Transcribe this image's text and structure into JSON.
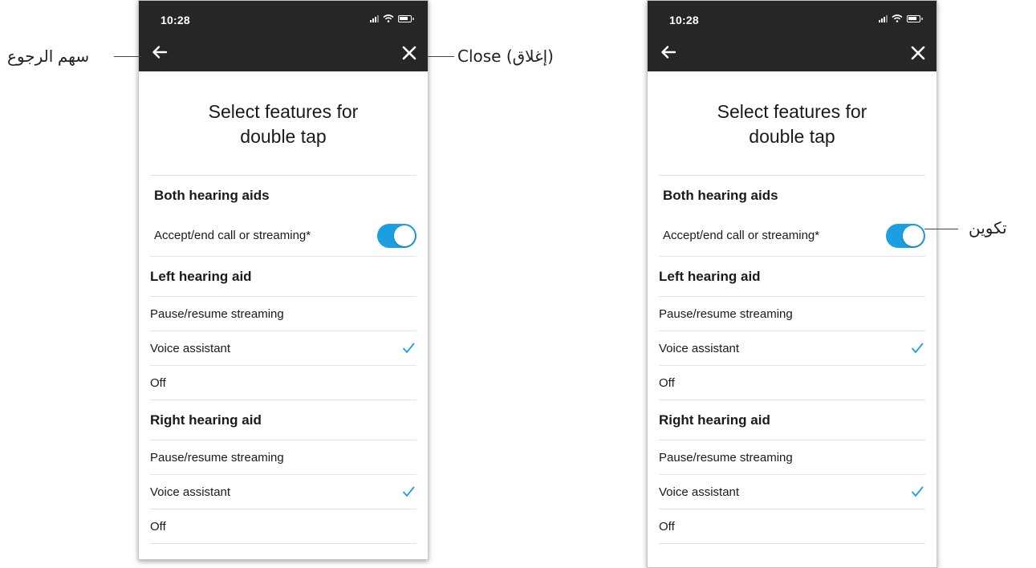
{
  "screens": [
    {
      "status_time": "10:28",
      "title_line1": "Select features for",
      "title_line2": "double tap",
      "both_header": "Both hearing aids",
      "toggle_label": "Accept/end call or streaming*",
      "left_header": "Left hearing aid",
      "left_options": [
        "Pause/resume streaming",
        "Voice assistant",
        "Off"
      ],
      "right_header": "Right hearing aid",
      "right_options": [
        "Pause/resume streaming",
        "Voice assistant",
        "Off"
      ]
    },
    {
      "status_time": "10:28",
      "title_line1": "Select features for",
      "title_line2": "double tap",
      "both_header": "Both hearing aids",
      "toggle_label": "Accept/end call or streaming*",
      "left_header": "Left hearing aid",
      "left_options": [
        "Pause/resume streaming",
        "Voice assistant",
        "Off"
      ],
      "right_header": "Right hearing aid",
      "right_options": [
        "Pause/resume streaming",
        "Voice assistant",
        "Off"
      ]
    }
  ],
  "toggle_state": "on",
  "selected_left": "Voice assistant",
  "selected_right": "Voice assistant",
  "annotations": {
    "back": "سهم الرجوع",
    "close": "Close (إغلاق)",
    "toggle": "تكوين"
  },
  "icons": {
    "back": "arrow-left-icon",
    "close": "close-icon",
    "check": "checkmark-icon",
    "signal": "signal-icon",
    "wifi": "wifi-icon",
    "battery": "battery-icon"
  },
  "colors": {
    "topbar": "#262626",
    "accent": "#1b9fe0",
    "divider": "#e3e3e3"
  }
}
